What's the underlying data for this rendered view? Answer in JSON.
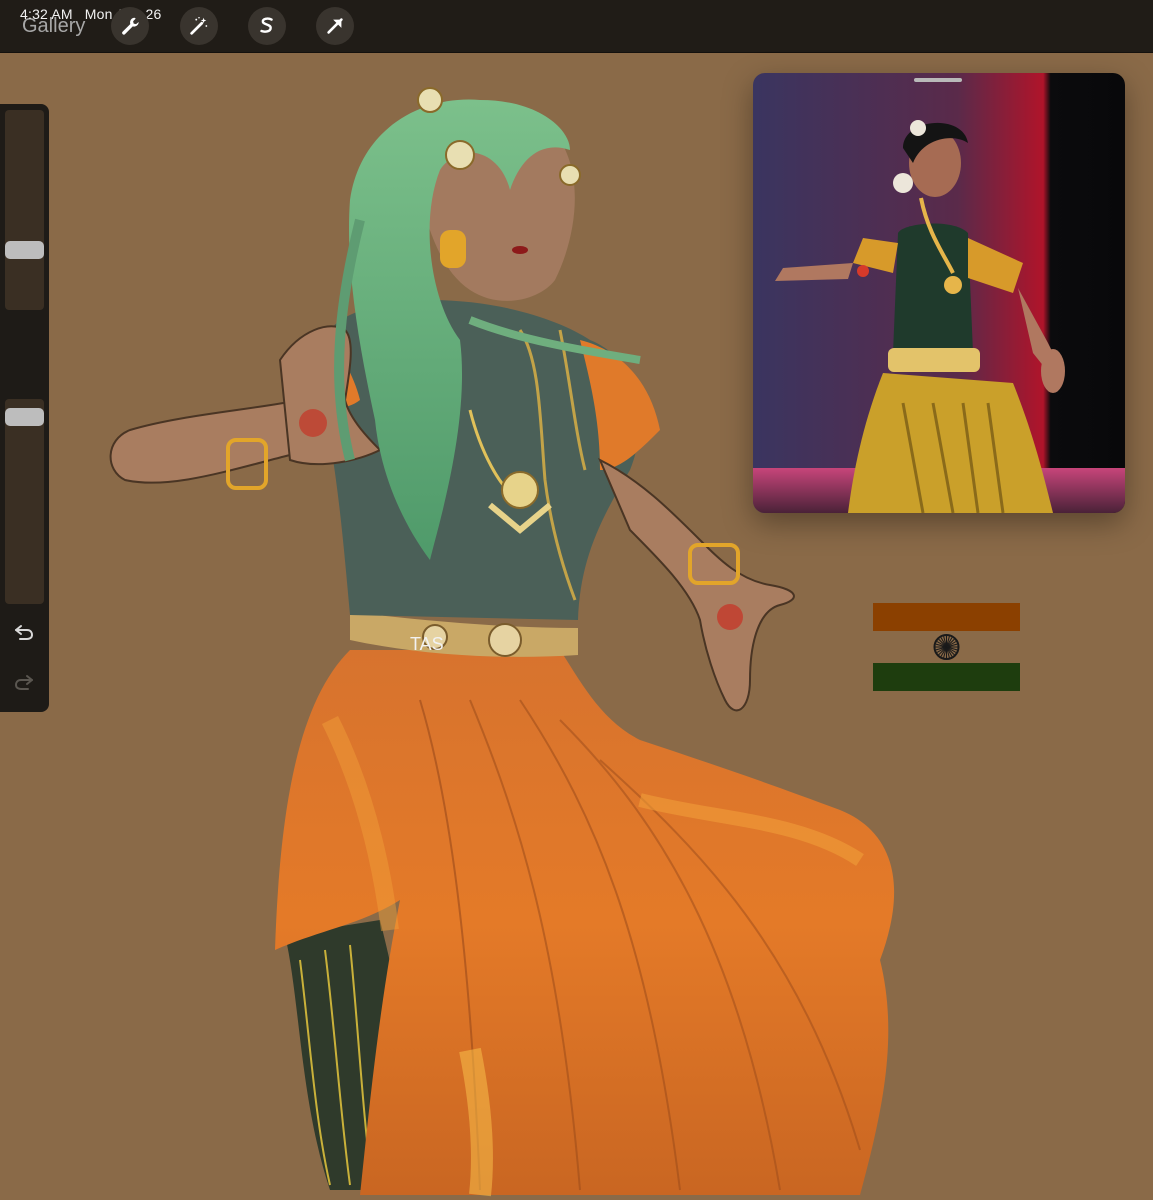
{
  "status": {
    "time": "4:32 AM",
    "date": "Mon Aug 26"
  },
  "toolbar": {
    "gallery_label": "Gallery",
    "tools": [
      {
        "icon": "wrench-icon"
      },
      {
        "icon": "magic-wand-icon"
      },
      {
        "icon": "selection-s-icon"
      },
      {
        "icon": "transform-arrow-icon"
      }
    ]
  },
  "sidebar": {
    "brush_size_level": 0.28,
    "opacity_level": 0.95,
    "icons": [
      "modify-square-icon",
      "undo-icon",
      "redo-icon"
    ]
  },
  "colors": {
    "canvas": "#8a6a48",
    "toolbar": "#201c17",
    "saffron": "#8b4000",
    "flag_green": "#1e3d0e",
    "skirt_orange": "#e07428",
    "hair_green": "#6fae7e",
    "blouse_green": "#4b6058",
    "gold": "#e2a52a"
  }
}
